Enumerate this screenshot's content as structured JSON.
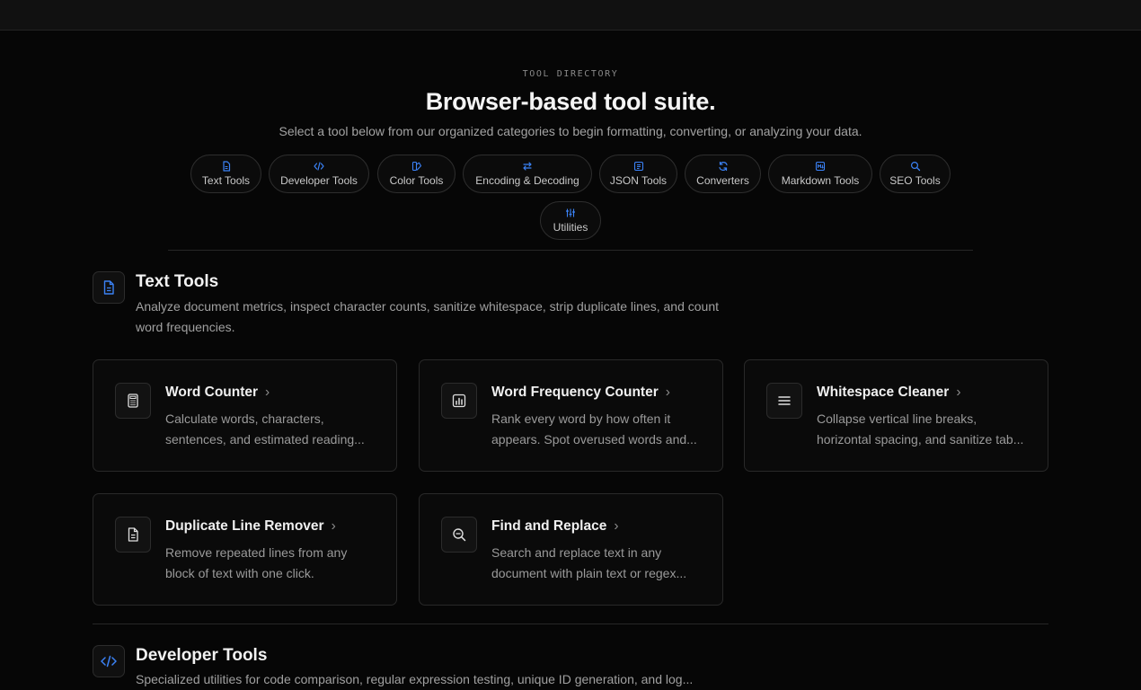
{
  "hero": {
    "eyebrow": "TOOL DIRECTORY",
    "title": "Browser-based tool suite.",
    "subtitle": "Select a tool below from our organized categories to begin formatting, converting, or analyzing your data."
  },
  "categories": [
    {
      "label": "Text Tools",
      "icon": "document-icon"
    },
    {
      "label": "Developer Tools",
      "icon": "code-icon"
    },
    {
      "label": "Color Tools",
      "icon": "palette-icon"
    },
    {
      "label": "Encoding & Decoding",
      "icon": "swap-arrows-icon"
    },
    {
      "label": "JSON Tools",
      "icon": "json-box-icon"
    },
    {
      "label": "Converters",
      "icon": "refresh-icon"
    },
    {
      "label": "Markdown Tools",
      "icon": "markdown-icon"
    },
    {
      "label": "SEO Tools",
      "icon": "search-icon"
    },
    {
      "label": "Utilities",
      "icon": "sliders-icon"
    }
  ],
  "sections": [
    {
      "title": "Text Tools",
      "icon": "document-icon",
      "description": "Analyze document metrics, inspect character counts, sanitize whitespace, strip duplicate lines, and count word frequencies.",
      "tools": [
        {
          "title": "Word Counter",
          "icon": "calculator-icon",
          "description": "Calculate words, characters, sentences, and estimated reading..."
        },
        {
          "title": "Word Frequency Counter",
          "icon": "bar-chart-icon",
          "description": "Rank every word by how often it appears. Spot overused words and..."
        },
        {
          "title": "Whitespace Cleaner",
          "icon": "menu-lines-icon",
          "description": "Collapse vertical line breaks, horizontal spacing, and sanitize tab..."
        },
        {
          "title": "Duplicate Line Remover",
          "icon": "file-text-icon",
          "description": "Remove repeated lines from any block of text with one click."
        },
        {
          "title": "Find and Replace",
          "icon": "zoom-search-icon",
          "description": "Search and replace text in any document with plain text or regex..."
        }
      ]
    },
    {
      "title": "Developer Tools",
      "icon": "code-icon",
      "description": "Specialized utilities for code comparison, regular expression testing, unique ID generation, and log..."
    }
  ],
  "colors": {
    "accent": "#3b82f6",
    "background": "#060606",
    "card_border": "#292929"
  }
}
